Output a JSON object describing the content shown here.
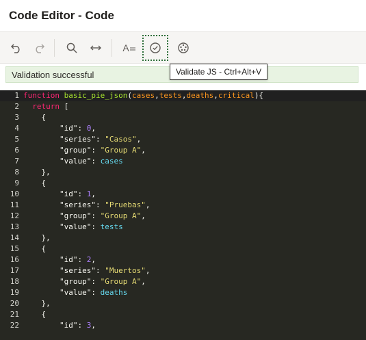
{
  "window": {
    "title": "Code Editor - Code"
  },
  "toolbar": {
    "undo_icon": "undo-icon",
    "redo_icon": "redo-icon",
    "search_icon": "search-icon",
    "replace_icon": "arrows-horizontal-icon",
    "format_label": "A",
    "validate_icon": "check-circle-icon",
    "settings_icon": "palette-icon"
  },
  "tooltip": {
    "text": "Validate JS - Ctrl+Alt+V"
  },
  "validation": {
    "message": "Validation successful"
  },
  "colors": {
    "editor_bg": "#272822",
    "validation_bg": "#e8f3e2",
    "keyword": "#f92672",
    "function_name": "#a6e22e",
    "param": "#fd971f",
    "string": "#e6db74",
    "number": "#ae81ff",
    "identifier": "#66d9ef"
  },
  "code": {
    "line_numbers": [
      "1",
      "2",
      "3",
      "4",
      "5",
      "6",
      "7",
      "8",
      "9",
      "10",
      "11",
      "12",
      "13",
      "14",
      "15",
      "16",
      "17",
      "18",
      "19",
      "20",
      "21",
      "22"
    ],
    "lines": [
      [
        {
          "t": "kw",
          "v": "function "
        },
        {
          "t": "fn",
          "v": "basic_pie_json"
        },
        {
          "t": "plain",
          "v": "("
        },
        {
          "t": "param",
          "v": "cases"
        },
        {
          "t": "plain",
          "v": ","
        },
        {
          "t": "param",
          "v": "tests"
        },
        {
          "t": "plain",
          "v": ","
        },
        {
          "t": "param",
          "v": "deaths"
        },
        {
          "t": "plain",
          "v": ","
        },
        {
          "t": "param",
          "v": "critical"
        },
        {
          "t": "plain",
          "v": "){"
        }
      ],
      [
        {
          "t": "plain",
          "v": "  "
        },
        {
          "t": "kw",
          "v": "return"
        },
        {
          "t": "plain",
          "v": " ["
        }
      ],
      [
        {
          "t": "plain",
          "v": "    {"
        }
      ],
      [
        {
          "t": "plain",
          "v": "        "
        },
        {
          "t": "plain",
          "v": "\"id\": "
        },
        {
          "t": "num",
          "v": "0"
        },
        {
          "t": "plain",
          "v": ","
        }
      ],
      [
        {
          "t": "plain",
          "v": "        "
        },
        {
          "t": "plain",
          "v": "\"series\": "
        },
        {
          "t": "str",
          "v": "\"Casos\""
        },
        {
          "t": "plain",
          "v": ","
        }
      ],
      [
        {
          "t": "plain",
          "v": "        "
        },
        {
          "t": "plain",
          "v": "\"group\": "
        },
        {
          "t": "str",
          "v": "\"Group A\""
        },
        {
          "t": "plain",
          "v": ","
        }
      ],
      [
        {
          "t": "plain",
          "v": "        "
        },
        {
          "t": "plain",
          "v": "\"value\": "
        },
        {
          "t": "id",
          "v": "cases"
        }
      ],
      [
        {
          "t": "plain",
          "v": "    },"
        }
      ],
      [
        {
          "t": "plain",
          "v": "    {"
        }
      ],
      [
        {
          "t": "plain",
          "v": "        "
        },
        {
          "t": "plain",
          "v": "\"id\": "
        },
        {
          "t": "num",
          "v": "1"
        },
        {
          "t": "plain",
          "v": ","
        }
      ],
      [
        {
          "t": "plain",
          "v": "        "
        },
        {
          "t": "plain",
          "v": "\"series\": "
        },
        {
          "t": "str",
          "v": "\"Pruebas\""
        },
        {
          "t": "plain",
          "v": ","
        }
      ],
      [
        {
          "t": "plain",
          "v": "        "
        },
        {
          "t": "plain",
          "v": "\"group\": "
        },
        {
          "t": "str",
          "v": "\"Group A\""
        },
        {
          "t": "plain",
          "v": ","
        }
      ],
      [
        {
          "t": "plain",
          "v": "        "
        },
        {
          "t": "plain",
          "v": "\"value\": "
        },
        {
          "t": "id",
          "v": "tests"
        }
      ],
      [
        {
          "t": "plain",
          "v": "    },"
        }
      ],
      [
        {
          "t": "plain",
          "v": "    {"
        }
      ],
      [
        {
          "t": "plain",
          "v": "        "
        },
        {
          "t": "plain",
          "v": "\"id\": "
        },
        {
          "t": "num",
          "v": "2"
        },
        {
          "t": "plain",
          "v": ","
        }
      ],
      [
        {
          "t": "plain",
          "v": "        "
        },
        {
          "t": "plain",
          "v": "\"series\": "
        },
        {
          "t": "str",
          "v": "\"Muertos\""
        },
        {
          "t": "plain",
          "v": ","
        }
      ],
      [
        {
          "t": "plain",
          "v": "        "
        },
        {
          "t": "plain",
          "v": "\"group\": "
        },
        {
          "t": "str",
          "v": "\"Group A\""
        },
        {
          "t": "plain",
          "v": ","
        }
      ],
      [
        {
          "t": "plain",
          "v": "        "
        },
        {
          "t": "plain",
          "v": "\"value\": "
        },
        {
          "t": "id",
          "v": "deaths"
        }
      ],
      [
        {
          "t": "plain",
          "v": "    },"
        }
      ],
      [
        {
          "t": "plain",
          "v": "    {"
        }
      ],
      [
        {
          "t": "plain",
          "v": "        "
        },
        {
          "t": "plain",
          "v": "\"id\": "
        },
        {
          "t": "num",
          "v": "3"
        },
        {
          "t": "plain",
          "v": ","
        }
      ]
    ]
  }
}
